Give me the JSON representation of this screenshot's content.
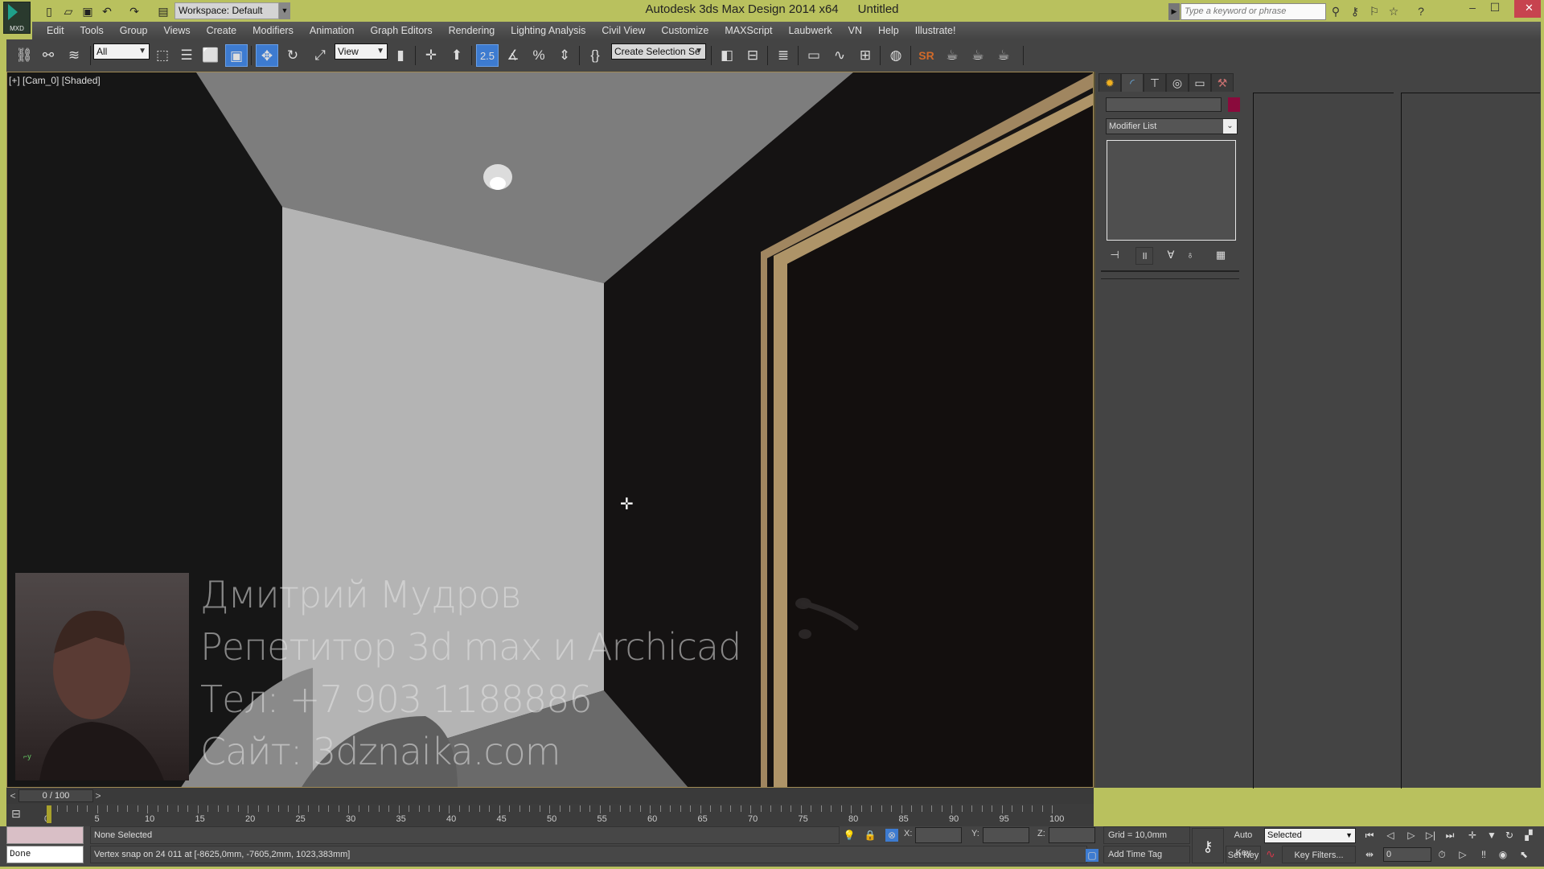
{
  "app": {
    "logo_label": "MXD",
    "title": "Autodesk 3ds Max Design 2014 x64",
    "document": "Untitled",
    "workspace": "Workspace: Default",
    "search_placeholder": "Type a keyword or phrase"
  },
  "quick_access": [
    "new-icon",
    "open-icon",
    "save-icon",
    "undo-icon",
    "redo-icon",
    "project-folder-icon"
  ],
  "menu": [
    "Edit",
    "Tools",
    "Group",
    "Views",
    "Create",
    "Modifiers",
    "Animation",
    "Graph Editors",
    "Rendering",
    "Lighting Analysis",
    "Civil View",
    "Customize",
    "MAXScript",
    "Laubwerk",
    "VN",
    "Help",
    "Illustrate!"
  ],
  "toolbar": {
    "selection_filter": "All",
    "reference_coord": "View",
    "snap_value": "2.5",
    "named_selection": "Create Selection Se",
    "sr_label": "SR"
  },
  "viewport": {
    "label": "[+] [Cam_0] [Shaded]",
    "overlay": {
      "name": "Дмитрий Мудров",
      "role": "Репетитор 3d max и Archicad",
      "phone": "Тел: +7 903 1188886",
      "site": "Сайт: 3dznaika.com"
    }
  },
  "command_panel": {
    "tabs": [
      "create-tab",
      "modify-tab",
      "hierarchy-tab",
      "motion-tab",
      "display-tab",
      "utilities-tab"
    ],
    "active_tab": 1,
    "object_color": "#8a0a3c",
    "modifier_list": "Modifier List"
  },
  "timeline": {
    "current": "0 / 100",
    "prev": "<",
    "next": ">",
    "start": 0,
    "end": 100,
    "labels": [
      0,
      5,
      10,
      15,
      20,
      25,
      30,
      35,
      40,
      45,
      50,
      55,
      60,
      65,
      70,
      75,
      80,
      85,
      90,
      95,
      100
    ]
  },
  "status": {
    "listener": "Done",
    "selection": "None Selected",
    "prompt": "Vertex snap on 24    011 at [-8625,0mm, -7605,2mm, 1023,383mm]",
    "x_label": "X:",
    "y_label": "Y:",
    "z_label": "Z:",
    "grid": "Grid = 10,0mm",
    "time_tag": "Add Time Tag",
    "auto_key": "Auto Key",
    "set_key": "Set Key",
    "key_set": "Selected",
    "key_filters": "Key Filters...",
    "frame": "0"
  }
}
